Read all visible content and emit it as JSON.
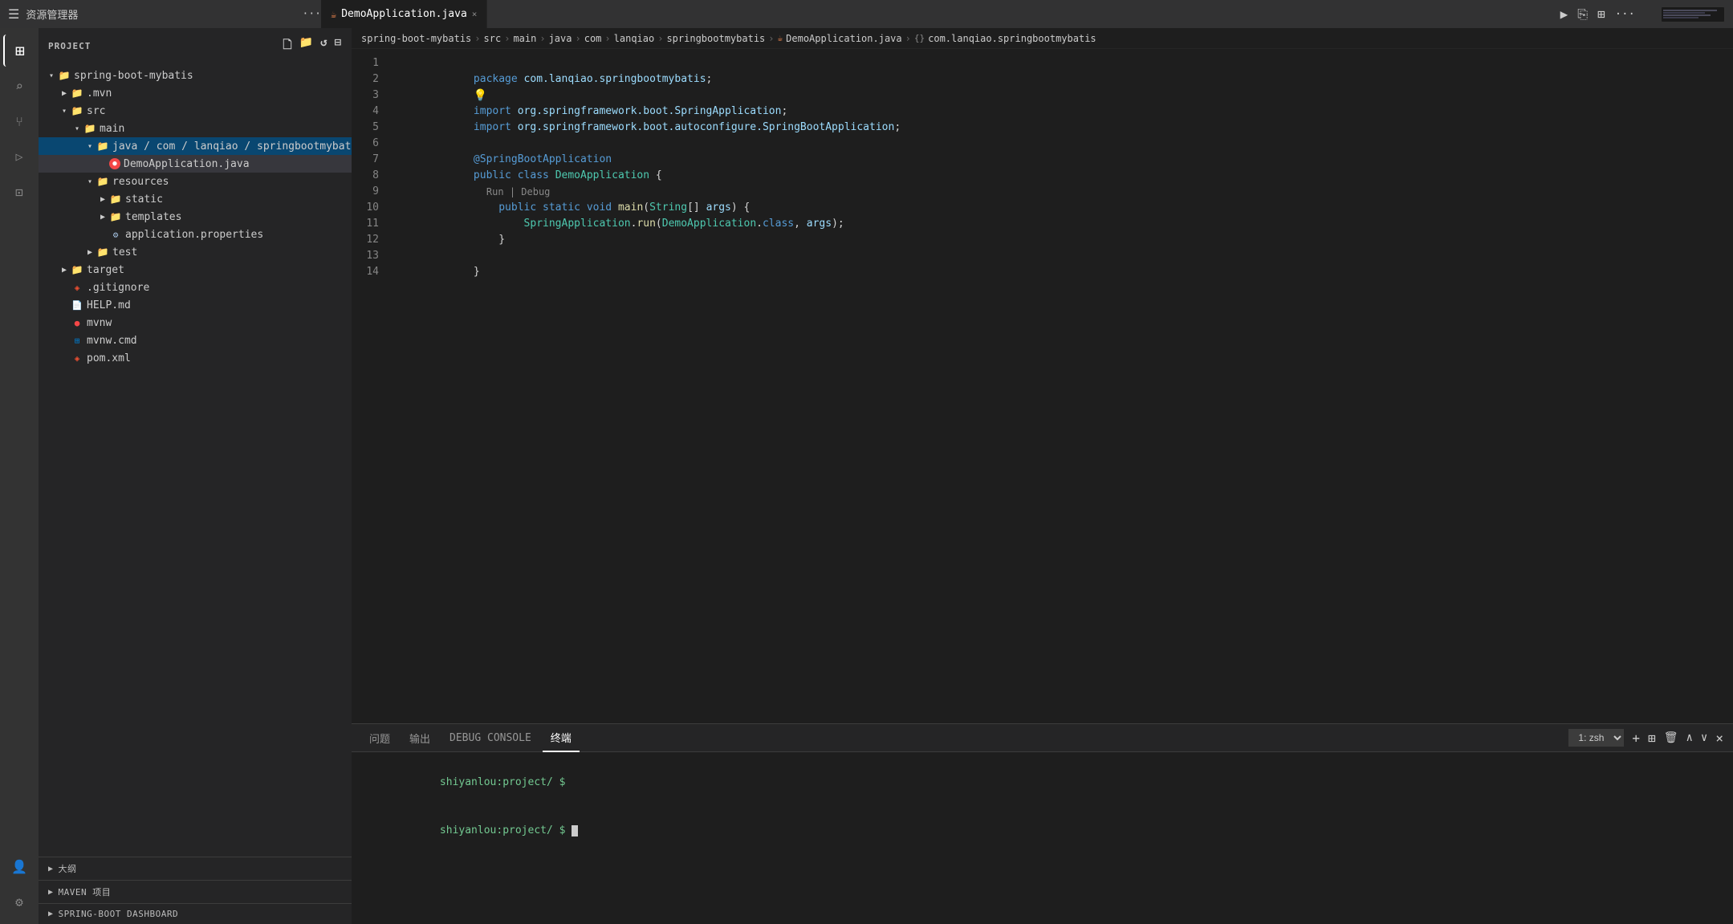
{
  "titleBar": {
    "resourceManager": "资源管理器",
    "dotsLabel": "···",
    "tab": {
      "label": "DemoApplication.java",
      "icon": "☕",
      "closeIcon": "×"
    },
    "actions": {
      "run": "▶",
      "split": "⎘",
      "layout": "⊞",
      "more": "···"
    }
  },
  "breadcrumb": {
    "path": [
      "spring-boot-mybatis",
      "src",
      "main",
      "java",
      "com",
      "lanqiao",
      "springbootmybatis"
    ],
    "file": "DemoApplication.java",
    "symbol": "{} com.lanqiao.springbootmybatis"
  },
  "sidebar": {
    "projectLabel": "PROJECT",
    "headerIcons": [
      "□+",
      "📁+",
      "↺",
      "⊟"
    ],
    "tree": [
      {
        "id": "spring-boot-mybatis",
        "label": "spring-boot-mybatis",
        "indent": 0,
        "type": "folder",
        "open": true
      },
      {
        "id": "mvn",
        "label": ".mvn",
        "indent": 1,
        "type": "folder-closed",
        "open": false
      },
      {
        "id": "src",
        "label": "src",
        "indent": 1,
        "type": "folder",
        "open": true
      },
      {
        "id": "main",
        "label": "main",
        "indent": 2,
        "type": "folder",
        "open": true
      },
      {
        "id": "java-path",
        "label": "java / com / lanqiao / springbootmybatis",
        "indent": 3,
        "type": "folder",
        "open": true,
        "highlighted": true
      },
      {
        "id": "DemoApplication",
        "label": "DemoApplication.java",
        "indent": 4,
        "type": "java-error"
      },
      {
        "id": "resources",
        "label": "resources",
        "indent": 3,
        "type": "folder",
        "open": true
      },
      {
        "id": "static",
        "label": "static",
        "indent": 4,
        "type": "folder-closed"
      },
      {
        "id": "templates",
        "label": "templates",
        "indent": 4,
        "type": "folder-closed"
      },
      {
        "id": "application.properties",
        "label": "application.properties",
        "indent": 4,
        "type": "props"
      },
      {
        "id": "test",
        "label": "test",
        "indent": 3,
        "type": "folder-closed"
      },
      {
        "id": "target",
        "label": "target",
        "indent": 1,
        "type": "folder-closed"
      },
      {
        "id": ".gitignore",
        "label": ".gitignore",
        "indent": 1,
        "type": "git"
      },
      {
        "id": "HELP.md",
        "label": "HELP.md",
        "indent": 1,
        "type": "help"
      },
      {
        "id": "mvnw",
        "label": "mvnw",
        "indent": 1,
        "type": "mvnw"
      },
      {
        "id": "mvnw.cmd",
        "label": "mvnw.cmd",
        "indent": 1,
        "type": "mvnwcmd"
      },
      {
        "id": "pom.xml",
        "label": "pom.xml",
        "indent": 1,
        "type": "pom"
      }
    ],
    "sections": [
      {
        "id": "outline",
        "label": "大纲"
      },
      {
        "id": "maven",
        "label": "MAVEN 项目"
      },
      {
        "id": "dashboard",
        "label": "SPRING-BOOT DASHBOARD"
      }
    ]
  },
  "activityBar": {
    "icons": [
      {
        "id": "explorer",
        "icon": "⊞",
        "active": true
      },
      {
        "id": "search",
        "icon": "🔍",
        "active": false
      },
      {
        "id": "source-control",
        "icon": "⑂",
        "active": false
      },
      {
        "id": "run-debug",
        "icon": "▷",
        "active": false
      },
      {
        "id": "extensions",
        "icon": "⊡",
        "active": false
      }
    ],
    "bottomIcons": [
      {
        "id": "account",
        "icon": "👤"
      },
      {
        "id": "settings",
        "icon": "⚙"
      }
    ]
  },
  "codeEditor": {
    "lines": [
      {
        "num": 1,
        "content": "package com.lanqiao.springbootmybatis;"
      },
      {
        "num": 2,
        "content": ""
      },
      {
        "num": 3,
        "content": "import org.springframework.boot.SpringApplication;"
      },
      {
        "num": 4,
        "content": "import org.springframework.boot.autoconfigure.SpringBootApplication;"
      },
      {
        "num": 5,
        "content": ""
      },
      {
        "num": 6,
        "content": "@SpringBootApplication"
      },
      {
        "num": 7,
        "content": "public class DemoApplication {"
      },
      {
        "num": 8,
        "content": ""
      },
      {
        "num": 9,
        "content": "    public static void main(String[] args) {"
      },
      {
        "num": 10,
        "content": "        SpringApplication.run(DemoApplication.class, args);"
      },
      {
        "num": 11,
        "content": "    }"
      },
      {
        "num": 12,
        "content": ""
      },
      {
        "num": 13,
        "content": "}"
      },
      {
        "num": 14,
        "content": ""
      }
    ],
    "inlineHint": "Run | Debug"
  },
  "bottomPanel": {
    "tabs": [
      {
        "id": "problems",
        "label": "问题"
      },
      {
        "id": "output",
        "label": "输出"
      },
      {
        "id": "debug-console",
        "label": "DEBUG CONSOLE"
      },
      {
        "id": "terminal",
        "label": "终端",
        "active": true
      }
    ],
    "terminalSelect": "1: zsh",
    "actions": {
      "add": "+",
      "split": "⊞",
      "trash": "🗑",
      "up": "∧",
      "down": "∨",
      "close": "×"
    },
    "terminalLines": [
      {
        "text": "shiyanlou:project/ $ ",
        "type": "prompt"
      },
      {
        "text": "shiyanlou:project/ $ ",
        "type": "prompt-cursor"
      }
    ]
  }
}
